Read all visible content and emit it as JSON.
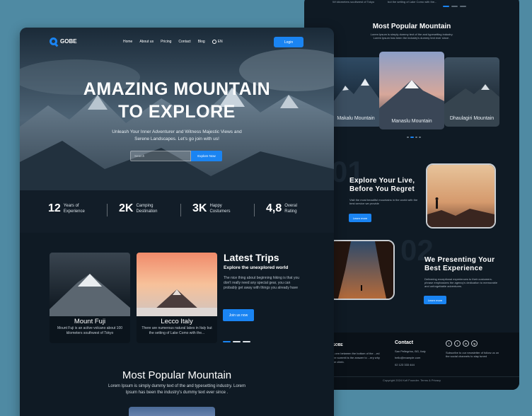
{
  "back_page": {
    "top_texts": [
      "Wi kilometers southwest of Tokyo",
      "but the setting of Lake Como with the..."
    ],
    "popular": {
      "title": "Most Popular Mountain",
      "subtitle": "Lorem Ipsum is simply dummy text of the and typesetting industry. Lorem Ipsum has been the industry's dummy text ever since .",
      "cards": [
        {
          "name": "Makalu Mountain"
        },
        {
          "name": "Manaslu Mountain"
        },
        {
          "name": "Dhaulagiri Mountain"
        }
      ]
    },
    "section1": {
      "number": "01",
      "title_line1": "Explore Your Live,",
      "title_line2": "Before You Regret",
      "text": "Visit the most beautiful mountains in the world with the best service we provide",
      "button": "Learn more"
    },
    "section2": {
      "number": "02",
      "title_line1": "We Presenting Your",
      "title_line2": "Best Experience",
      "text": "Delivering exceptional experiences to their customers. phrase emphasizes the agency's dedication to memorable and unforgettable adventures.",
      "button": "Learn more"
    },
    "footer": {
      "logo": "GOBE",
      "about": "...orm between the bottom of the ...ed the summit is the answer to ...ery why we climb.",
      "contact_title": "Contact",
      "address": "San Pellegrino, BG, Italy",
      "email": "hello@example.com",
      "phone": "02 123 333 444",
      "newsletter": "Subscribe to our newsletter of follow us on the social channels to stay tuned",
      "social": [
        "t",
        "f",
        "in",
        "ig"
      ],
      "copyright": "Copyright 2024 Kofi Founder. Terms & Privacy"
    }
  },
  "nav": {
    "logo": "GOBE",
    "links": [
      "Home",
      "About us",
      "Pricing",
      "Contact",
      "Blog"
    ],
    "lang": "EN",
    "login": "Login"
  },
  "hero": {
    "title_line1": "AMAZING MOUNTAIN",
    "title_line2": "TO EXPLORE",
    "subtitle": "Unleash Your Inner Adventurer and Witness Majestic Views and Serene Landscapes. Let's go join with us!",
    "search_placeholder": "Search",
    "search_button": "Explore Now"
  },
  "stats": [
    {
      "value": "12",
      "label_line1": "Years of",
      "label_line2": "Experience"
    },
    {
      "value": "2K",
      "label_line1": "Camping",
      "label_line2": "Destination"
    },
    {
      "value": "3K",
      "label_line1": "Happy",
      "label_line2": "Costumers"
    },
    {
      "value": "4,8",
      "label_line1": "Overal",
      "label_line2": "Rating"
    }
  ],
  "trips": {
    "cards": [
      {
        "title": "Mount Fuji",
        "desc": "Mount Fuji is an active volcano about 100 kilometers southwest of Tokyo"
      },
      {
        "title": "Lecco Italy",
        "desc": "There are numerous natural lakes in Italy but the setting of Lake Como with the..."
      }
    ],
    "heading": "Latest Trips",
    "subheading": "Explore the unexplored world",
    "text": "The nice thing about beginning hiking is that you don't really need any special gear, you can probably get away with things you already have",
    "button": "Join us now"
  },
  "popular": {
    "title": "Most Popular Mountain",
    "subtitle": "Lorem Ipsum is simply dummy text of the and typesetting industry. Lorem Ipsum has been the industry's  dummy text ever since ."
  },
  "colors": {
    "accent": "#1a84f2",
    "background": "#0f1a24",
    "canvas": "#4f8aa3"
  }
}
